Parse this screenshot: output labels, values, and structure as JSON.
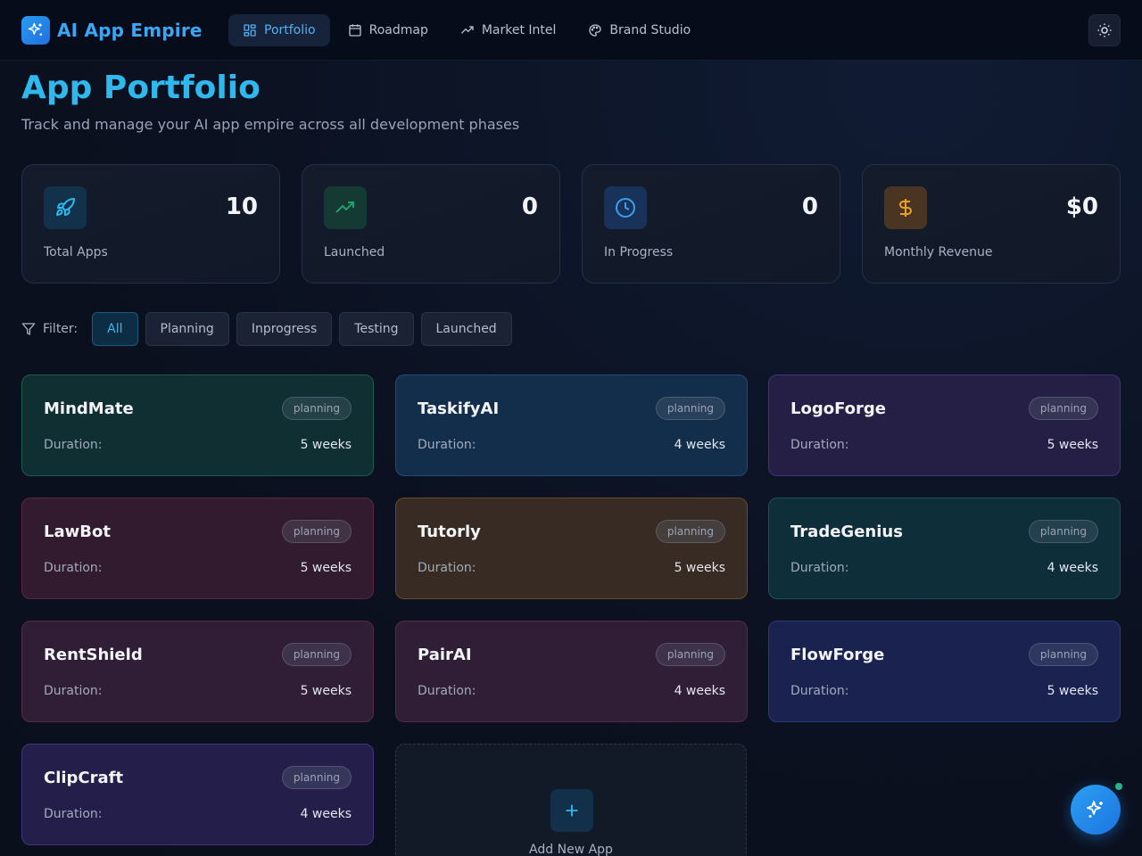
{
  "header": {
    "brand": "AI App Empire",
    "nav": [
      {
        "label": "Portfolio",
        "icon": "grid-icon",
        "active": true
      },
      {
        "label": "Roadmap",
        "icon": "calendar-icon",
        "active": false
      },
      {
        "label": "Market Intel",
        "icon": "trending-up-icon",
        "active": false
      },
      {
        "label": "Brand Studio",
        "icon": "palette-icon",
        "active": false
      }
    ],
    "theme_icon": "sun-icon"
  },
  "page": {
    "title": "App Portfolio",
    "subtitle": "Track and manage your AI app empire across all development phases"
  },
  "stats": [
    {
      "label": "Total Apps",
      "value": "10",
      "icon": "rocket-icon",
      "color": "#2fb8ee"
    },
    {
      "label": "Launched",
      "value": "0",
      "icon": "trending-up-icon",
      "color": "#22a06b"
    },
    {
      "label": "In Progress",
      "value": "0",
      "icon": "clock-icon",
      "color": "#3a8ff0"
    },
    {
      "label": "Monthly Revenue",
      "value": "$0",
      "icon": "dollar-icon",
      "color": "#f0a020"
    }
  ],
  "filter": {
    "label": "Filter:",
    "options": [
      "All",
      "Planning",
      "Inprogress",
      "Testing",
      "Launched"
    ],
    "selected": "All"
  },
  "apps": [
    {
      "name": "MindMate",
      "status": "planning",
      "duration_label": "Duration:",
      "duration": "5 weeks"
    },
    {
      "name": "TaskifyAI",
      "status": "planning",
      "duration_label": "Duration:",
      "duration": "4 weeks"
    },
    {
      "name": "LogoForge",
      "status": "planning",
      "duration_label": "Duration:",
      "duration": "5 weeks"
    },
    {
      "name": "LawBot",
      "status": "planning",
      "duration_label": "Duration:",
      "duration": "5 weeks"
    },
    {
      "name": "Tutorly",
      "status": "planning",
      "duration_label": "Duration:",
      "duration": "5 weeks"
    },
    {
      "name": "TradeGenius",
      "status": "planning",
      "duration_label": "Duration:",
      "duration": "4 weeks"
    },
    {
      "name": "RentShield",
      "status": "planning",
      "duration_label": "Duration:",
      "duration": "5 weeks"
    },
    {
      "name": "PairAI",
      "status": "planning",
      "duration_label": "Duration:",
      "duration": "4 weeks"
    },
    {
      "name": "FlowForge",
      "status": "planning",
      "duration_label": "Duration:",
      "duration": "5 weeks"
    },
    {
      "name": "ClipCraft",
      "status": "planning",
      "duration_label": "Duration:",
      "duration": "4 weeks"
    }
  ],
  "add_card": {
    "label": "Add New App",
    "icon": "plus-icon"
  },
  "fab": {
    "icon": "sparkles-icon"
  }
}
